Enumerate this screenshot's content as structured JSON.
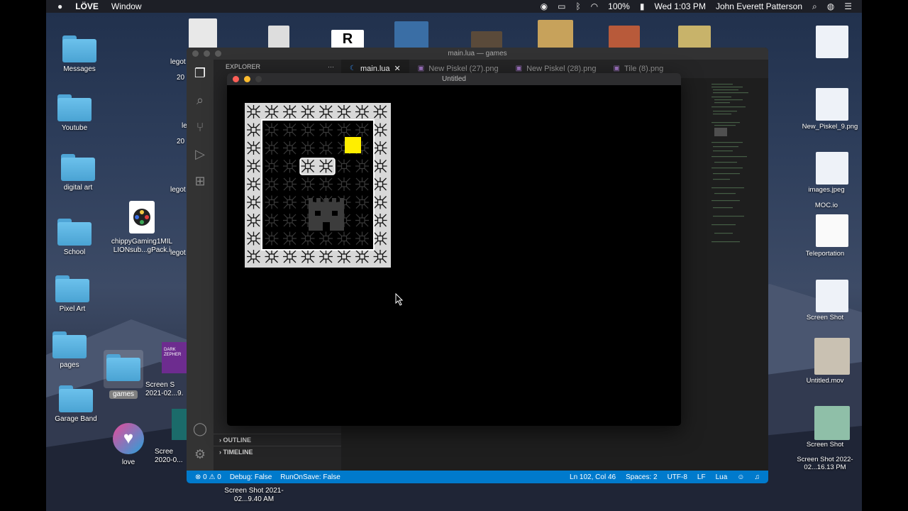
{
  "menubar": {
    "app_name": "LÖVE",
    "menu_window": "Window",
    "battery": "100%",
    "datetime": "Wed 1:03 PM",
    "user": "John Everett Patterson"
  },
  "desktop_left": [
    {
      "label": "Messages"
    },
    {
      "label": "Youtube"
    },
    {
      "label": "digital art"
    },
    {
      "label": "School"
    },
    {
      "label": "Pixel Art"
    },
    {
      "label": "pages"
    },
    {
      "label": "Garage Band"
    }
  ],
  "desktop_misc": {
    "chippy_label": "chippyGaming1MIL LIONsub...gPack.i",
    "games_label": "games",
    "screen_label_1": "Screen S 2021-02...9.",
    "screen_label_2": "Scree 2020-0...",
    "love_label": "love",
    "bottom_label": "Screen Shot 2021-02...9.40 AM",
    "lego_labels": [
      "legot",
      "20",
      "le",
      "20",
      "legot",
      "legot"
    ],
    "badge_purple": "DARK ZEPHER"
  },
  "desktop_right": [
    {
      "label": "New_Piskel_9.png"
    },
    {
      "label": "images.jpeg"
    },
    {
      "label": "MOC.io"
    },
    {
      "label": "Teleportation"
    },
    {
      "label": "Screen Shot"
    },
    {
      "label": "Untitled.mov"
    },
    {
      "label": "Screen Shot"
    },
    {
      "label": "Screen Shot 2022-02...16.13 PM"
    }
  ],
  "vscode": {
    "title": "main.lua — games",
    "explorer_label": "EXPLORER",
    "outline_label": "OUTLINE",
    "timeline_label": "TIMELINE",
    "tabs": [
      {
        "label": "main.lua",
        "active": true
      },
      {
        "label": "New Piskel (27).png",
        "active": false
      },
      {
        "label": "New Piskel (28).png",
        "active": false
      },
      {
        "label": "Tile (8).png",
        "active": false
      }
    ],
    "status": {
      "errors": "⊗ 0 ⚠ 0",
      "debug": "Debug: False",
      "runonsave": "RunOnSave: False",
      "position": "Ln 102, Col 46",
      "spaces": "Spaces: 2",
      "encoding": "UTF-8",
      "eol": "LF",
      "language": "Lua"
    }
  },
  "love_window": {
    "title": "Untitled",
    "player_color": "#ffee00"
  }
}
